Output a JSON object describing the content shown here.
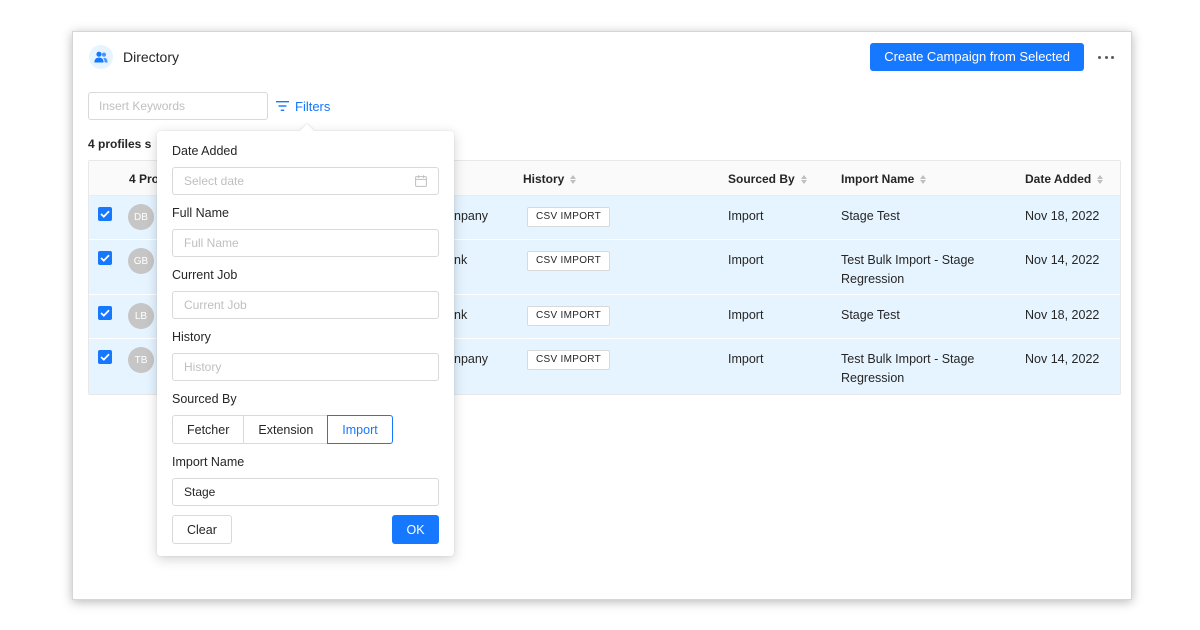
{
  "header": {
    "title": "Directory",
    "create_button": "Create Campaign from Selected",
    "more_icon": "ellipsis-icon"
  },
  "search": {
    "placeholder": "Insert Keywords",
    "value": "",
    "filters_label": "Filters"
  },
  "selected_info": "4 profiles s",
  "table": {
    "columns": [
      {
        "label": "4 Pro",
        "sortable": false
      },
      {
        "label": "History",
        "sortable": true
      },
      {
        "label": "Sourced By",
        "sortable": true
      },
      {
        "label": "Import Name",
        "sortable": true
      },
      {
        "label": "Date Added",
        "sortable": true
      }
    ],
    "rows": [
      {
        "checked": true,
        "initials": "DB",
        "partial": "npany",
        "history": "CSV IMPORT",
        "sourced_by": "Import",
        "import_name": "Stage Test",
        "date_added": "Nov 18, 2022"
      },
      {
        "checked": true,
        "initials": "GB",
        "partial": "nk",
        "history": "CSV IMPORT",
        "sourced_by": "Import",
        "import_name": "Test Bulk Import - Stage Regression",
        "date_added": "Nov 14, 2022"
      },
      {
        "checked": true,
        "initials": "LB",
        "partial": "nk",
        "history": "CSV IMPORT",
        "sourced_by": "Import",
        "import_name": "Stage Test",
        "date_added": "Nov 18, 2022"
      },
      {
        "checked": true,
        "initials": "TB",
        "partial": "npany",
        "history": "CSV IMPORT",
        "sourced_by": "Import",
        "import_name": "Test Bulk Import - Stage Regression",
        "date_added": "Nov 14, 2022"
      }
    ]
  },
  "filter_panel": {
    "date_added": {
      "label": "Date Added",
      "placeholder": "Select date"
    },
    "full_name": {
      "label": "Full Name",
      "placeholder": "Full Name",
      "value": ""
    },
    "current_job": {
      "label": "Current Job",
      "placeholder": "Current Job",
      "value": ""
    },
    "history": {
      "label": "History",
      "placeholder": "History",
      "value": ""
    },
    "sourced_by": {
      "label": "Sourced By",
      "options": [
        "Fetcher",
        "Extension",
        "Import"
      ],
      "selected": "Import"
    },
    "import_name": {
      "label": "Import Name",
      "value": "Stage"
    },
    "clear_label": "Clear",
    "ok_label": "OK"
  },
  "colors": {
    "accent": "#1677ff",
    "row_selected": "#e6f4ff",
    "avatar": "#c6c6c6"
  }
}
